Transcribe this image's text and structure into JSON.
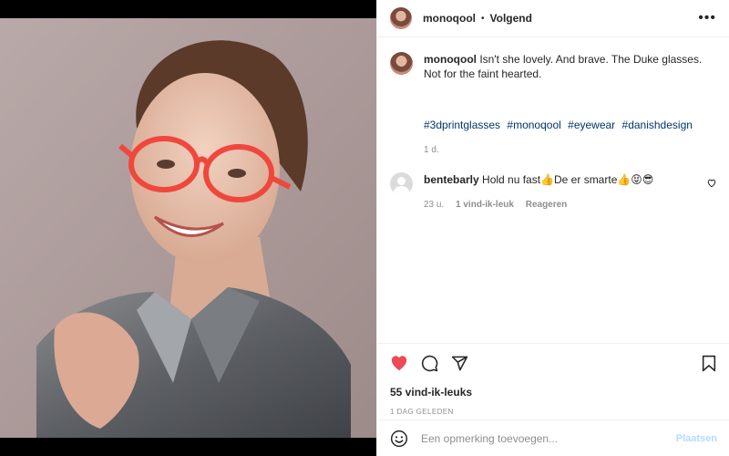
{
  "header": {
    "username": "monoqool",
    "separator": "•",
    "follow_label": "Volgend",
    "more_icon": "more-horizontal-icon",
    "more_label": "•••"
  },
  "caption": {
    "username": "monoqool",
    "text": "Isn't she lovely. And brave. The Duke glasses. Not for the faint hearted.",
    "hashtags": [
      "#3dprintglasses",
      "#monoqool",
      "#eyewear",
      "#danishdesign"
    ],
    "age": "1 d."
  },
  "comments": [
    {
      "username": "bentebarly",
      "text": "Hold nu fast👍De er smarte👍😝😎",
      "age": "23 u.",
      "likes": "1 vind-ik-leuk",
      "reply_label": "Reageren"
    }
  ],
  "actions": {
    "like_icon": "heart-filled-icon",
    "comment_icon": "comment-icon",
    "share_icon": "send-icon",
    "save_icon": "bookmark-icon",
    "like_color": "#ed4956"
  },
  "likes_text": "55 vind-ik-leuks",
  "date_text": "1 DAG GELEDEN",
  "add_comment": {
    "placeholder": "Een opmerking toevoegen...",
    "post_label": "Plaatsen",
    "emoji_icon": "emoji-smile-icon"
  }
}
